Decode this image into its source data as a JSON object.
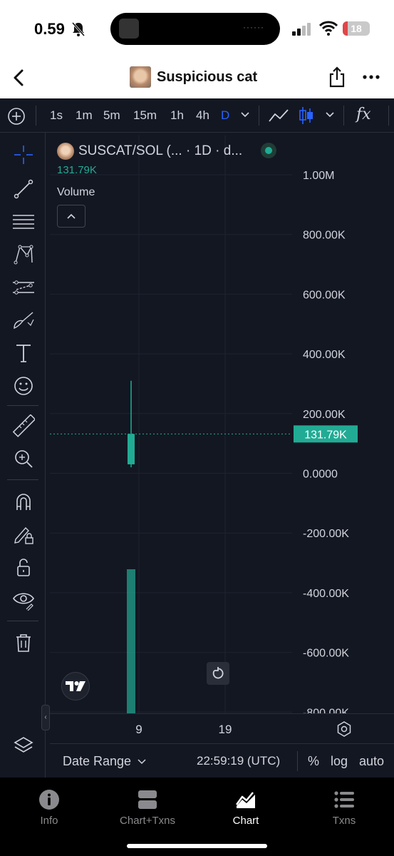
{
  "status_bar": {
    "time": "0.59",
    "battery_level": "18",
    "battery_fraction": 0.18
  },
  "header": {
    "title": "Suspicious cat"
  },
  "toolbar": {
    "timeframes": [
      {
        "label": "1s",
        "active": false
      },
      {
        "label": "1m",
        "active": false
      },
      {
        "label": "5m",
        "active": false
      },
      {
        "label": "15m",
        "active": false
      },
      {
        "label": "1h",
        "active": false
      },
      {
        "label": "4h",
        "active": false
      },
      {
        "label": "D",
        "active": true
      }
    ],
    "indicators_label": "fx"
  },
  "left_tools": [
    "crosshair-icon",
    "trend-line-icon",
    "fib-retracement-icon",
    "pattern-icon",
    "prediction-icon",
    "brush-icon",
    "text-icon",
    "emoji-icon",
    "ruler-icon",
    "zoom-in-icon",
    "magnet-icon",
    "lock-drawing-icon",
    "unlock-icon",
    "eye-icon",
    "trash-icon",
    "layers-icon"
  ],
  "chart": {
    "legend_title": "SUSCAT/SOL (... · 1D · d...",
    "legend_value": "131.79K",
    "volume_label": "Volume",
    "price_axis_labels": [
      "1.00M",
      "800.00K",
      "600.00K",
      "400.00K",
      "200.00K",
      "0.0000",
      "-200.00K",
      "-400.00K",
      "-600.00K",
      "-800.00K"
    ],
    "current_price_label": "131.79K",
    "time_ticks": [
      "9",
      "19"
    ]
  },
  "chart_data": {
    "type": "candlestick",
    "y_range": [
      -800000,
      1000000
    ],
    "x_ticks": [
      "9",
      "19"
    ],
    "candles": [
      {
        "x": "9",
        "open": 30000,
        "high": 310000,
        "low": 20000,
        "close": 131790
      }
    ],
    "volume_bars": [
      {
        "x": "9",
        "value": 1
      }
    ],
    "last_value": 131790,
    "colors": {
      "up": "#22ab94",
      "grid": "#1f2330",
      "text": "#d1d4dc"
    }
  },
  "bottom_bar": {
    "date_range_label": "Date Range",
    "clock": "22:59:19 (UTC)",
    "percent_label": "%",
    "log_label": "log",
    "auto_label": "auto"
  },
  "tabbar": {
    "tabs": [
      {
        "label": "Info",
        "icon": "info-icon",
        "active": false
      },
      {
        "label": "Chart+Txns",
        "icon": "chart-txns-icon",
        "active": false
      },
      {
        "label": "Chart",
        "icon": "chart-icon",
        "active": true
      },
      {
        "label": "Txns",
        "icon": "list-icon",
        "active": false
      }
    ]
  }
}
